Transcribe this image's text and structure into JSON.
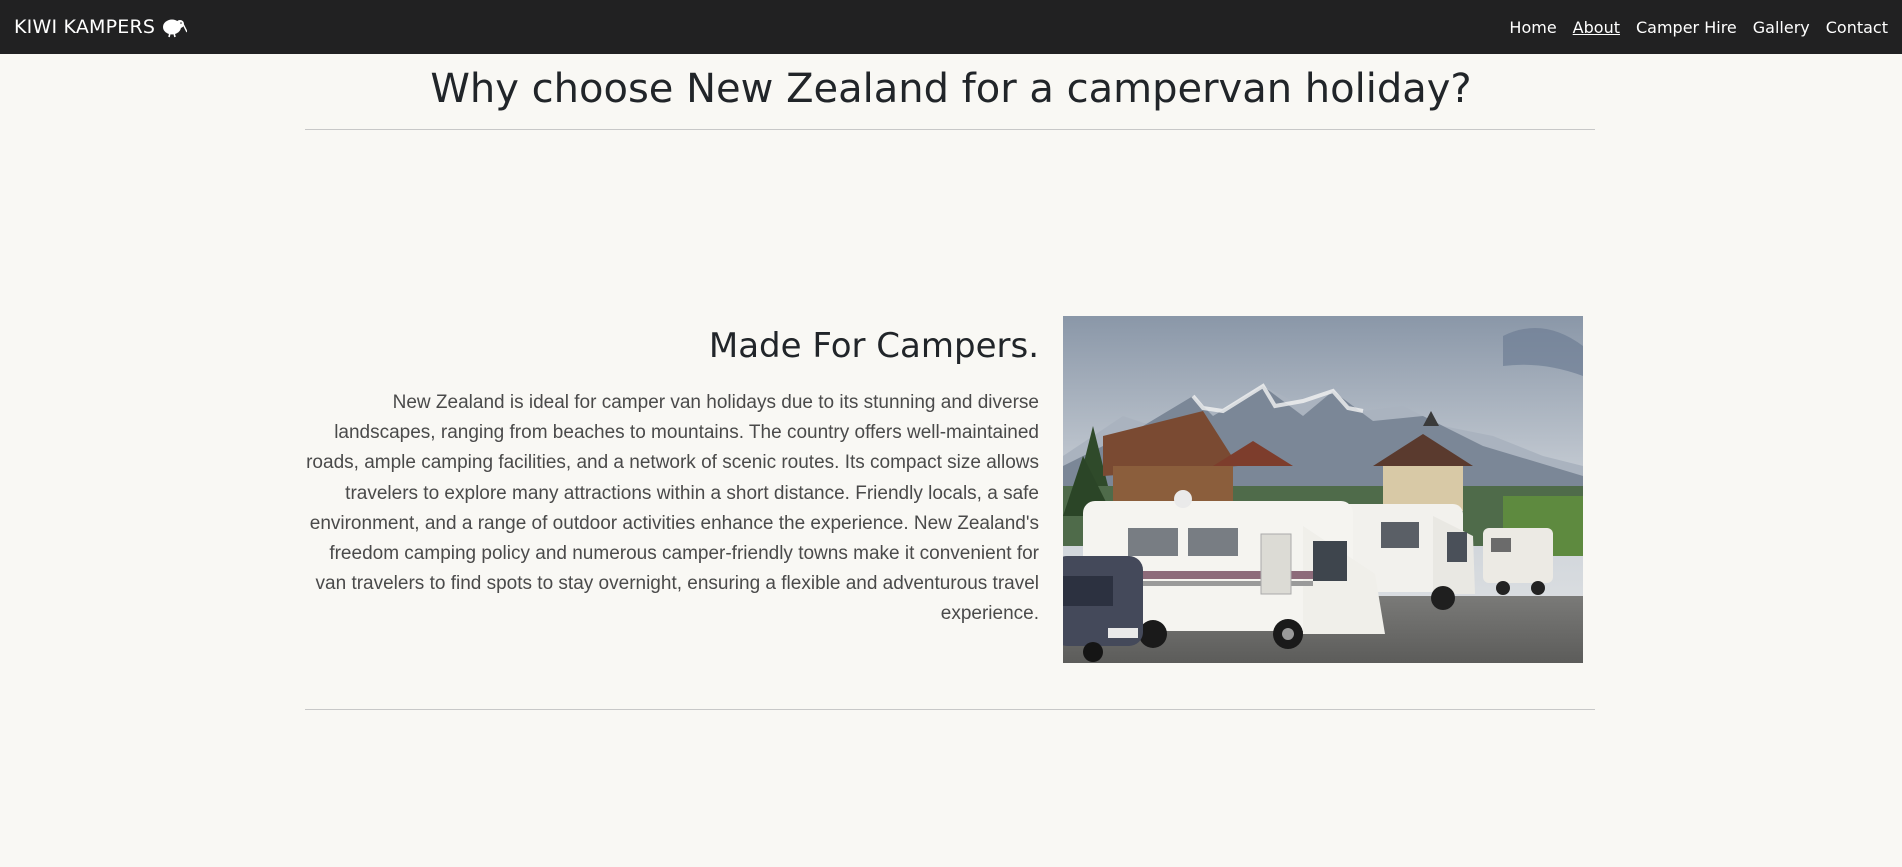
{
  "navbar": {
    "brand": "KIWI KAMPERS",
    "brand_icon": "kiwi-bird-icon",
    "links": [
      {
        "label": "Home",
        "active": false
      },
      {
        "label": "About",
        "active": true
      },
      {
        "label": "Camper Hire",
        "active": false
      },
      {
        "label": "Gallery",
        "active": false
      },
      {
        "label": "Contact",
        "active": false
      }
    ]
  },
  "page": {
    "title": "Why choose New Zealand for a campervan holiday?"
  },
  "section": {
    "heading": "Made For Campers.",
    "body": "New Zealand is ideal for camper van holidays due to its stunning and diverse landscapes, ranging from beaches to mountains. The country offers well-maintained roads, ample camping facilities, and a network of scenic routes. Its compact size allows travelers to explore many attractions within a short distance. Friendly locals, a safe environment, and a range of outdoor activities enhance the experience. New Zealand's freedom camping policy and numerous camper-friendly towns make it convenient for van travelers to find spots to stay overnight, ensuring a flexible and adventurous travel experience."
  },
  "colors": {
    "navbar_bg": "#212122",
    "page_bg": "#f9f8f4",
    "text": "#212529"
  }
}
